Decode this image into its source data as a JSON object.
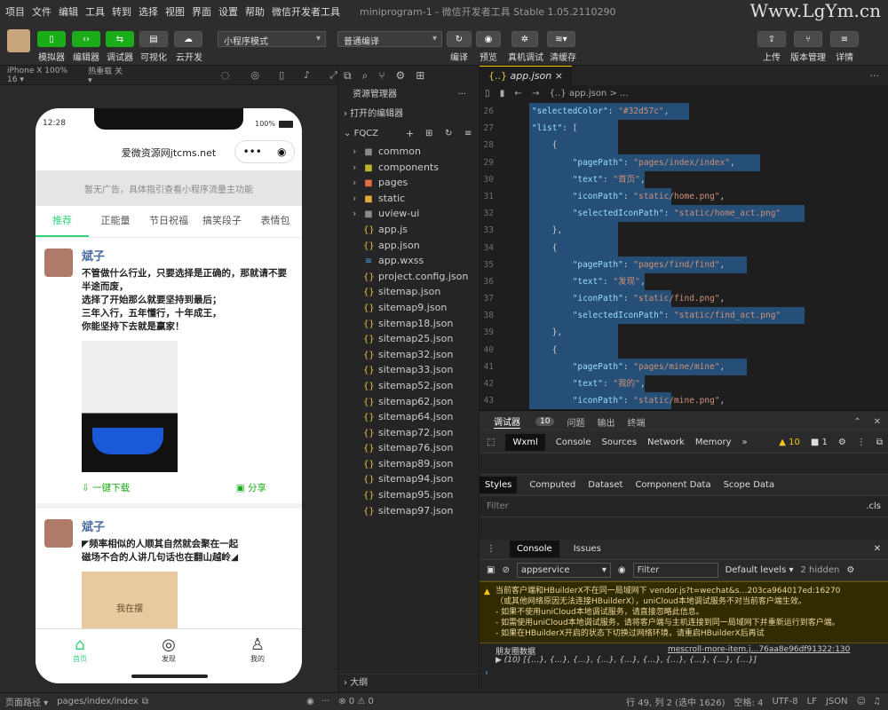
{
  "menu": [
    "项目",
    "文件",
    "编辑",
    "工具",
    "转到",
    "选择",
    "视图",
    "界面",
    "设置",
    "帮助",
    "微信开发者工具"
  ],
  "window_title": "miniprogram-1 - 微信开发者工具 Stable 1.05.2110290",
  "brand": "Www.LgYm.cn",
  "toolbar": {
    "simulator": "模拟器",
    "editor": "编辑器",
    "debugger": "调试器",
    "visual": "可视化",
    "cloud": "云开发",
    "mode": "小程序模式",
    "compile_mode": "普通编译",
    "compile": "编译",
    "preview": "预览",
    "real_debug": "真机调试",
    "clear_cache": "清缓存",
    "upload": "上传",
    "version": "版本管理",
    "details": "详情"
  },
  "simbar": {
    "device": "iPhone X 100% 16 ▾",
    "hotreload": "热重载 关 ▾"
  },
  "phone": {
    "time": "12:28",
    "battery": "100%",
    "nav_title": "爱微资源网jtcms.net",
    "ad": "暂无广告，具体指引查看小程序流量主功能",
    "tabs": [
      "推荐",
      "正能量",
      "节日祝福",
      "搞笑段子",
      "表情包"
    ],
    "posts": [
      {
        "user": "斌子",
        "text": "不管做什么行业，只要选择是正确的，那就请不要半途而废，\n选择了开始那么就要坚持到最后；\n三年入行，五年懂行，十年成王，\n你能坚持下去就是赢家！",
        "download": "一键下载",
        "share": "分享"
      },
      {
        "user": "斌子",
        "text": "◤频率相似的人顺其自然就会聚在一起\n磁场不合的人讲几句话也在翻山越岭◢",
        "img_text": "我在摆"
      }
    ],
    "bottom": [
      "首页",
      "发现",
      "我的"
    ]
  },
  "explorer": {
    "title": "资源管理器",
    "open_editors": "打开的编辑器",
    "project": "FQCZ",
    "outline": "大纲",
    "files": [
      {
        "name": "common",
        "type": "folder",
        "color": "#8a8a8a"
      },
      {
        "name": "components",
        "type": "folder",
        "color": "#c0b22a"
      },
      {
        "name": "pages",
        "type": "folder",
        "color": "#e06c4a"
      },
      {
        "name": "static",
        "type": "folder",
        "color": "#e0a83a"
      },
      {
        "name": "uview-ui",
        "type": "folder",
        "color": "#8a8a8a"
      },
      {
        "name": "app.js",
        "type": "js",
        "color": "#e8c03a"
      },
      {
        "name": "app.json",
        "type": "json",
        "color": "#e8c03a"
      },
      {
        "name": "app.wxss",
        "type": "wxss",
        "color": "#4aa0e0"
      },
      {
        "name": "project.config.json",
        "type": "json",
        "color": "#e8c03a"
      },
      {
        "name": "sitemap.json",
        "type": "json",
        "color": "#e8c03a"
      },
      {
        "name": "sitemap9.json",
        "type": "json",
        "color": "#e8c03a"
      },
      {
        "name": "sitemap18.json",
        "type": "json",
        "color": "#e8c03a"
      },
      {
        "name": "sitemap25.json",
        "type": "json",
        "color": "#e8c03a"
      },
      {
        "name": "sitemap32.json",
        "type": "json",
        "color": "#e8c03a"
      },
      {
        "name": "sitemap33.json",
        "type": "json",
        "color": "#e8c03a"
      },
      {
        "name": "sitemap52.json",
        "type": "json",
        "color": "#e8c03a"
      },
      {
        "name": "sitemap62.json",
        "type": "json",
        "color": "#e8c03a"
      },
      {
        "name": "sitemap64.json",
        "type": "json",
        "color": "#e8c03a"
      },
      {
        "name": "sitemap72.json",
        "type": "json",
        "color": "#e8c03a"
      },
      {
        "name": "sitemap76.json",
        "type": "json",
        "color": "#e8c03a"
      },
      {
        "name": "sitemap89.json",
        "type": "json",
        "color": "#e8c03a"
      },
      {
        "name": "sitemap94.json",
        "type": "json",
        "color": "#e8c03a"
      },
      {
        "name": "sitemap95.json",
        "type": "json",
        "color": "#e8c03a"
      },
      {
        "name": "sitemap97.json",
        "type": "json",
        "color": "#e8c03a"
      }
    ]
  },
  "editor": {
    "tab": "app.json",
    "breadcrumb": "{..} app.json > ...",
    "lines": [
      {
        "n": "26",
        "ind": 3,
        "c": [
          [
            "k",
            "\"selectedColor\""
          ],
          [
            "p",
            ": "
          ],
          [
            "s",
            "\"#32d57c\""
          ],
          [
            "p",
            ","
          ]
        ]
      },
      {
        "n": "27",
        "ind": 3,
        "c": [
          [
            "k",
            "\"list\""
          ],
          [
            "p",
            ": ["
          ]
        ]
      },
      {
        "n": "28",
        "ind": 4,
        "c": [
          [
            "p",
            "{"
          ]
        ]
      },
      {
        "n": "29",
        "ind": 5,
        "c": [
          [
            "k",
            "\"pagePath\""
          ],
          [
            "p",
            ": "
          ],
          [
            "s",
            "\"pages/index/index\""
          ],
          [
            "p",
            ","
          ]
        ]
      },
      {
        "n": "30",
        "ind": 5,
        "c": [
          [
            "k",
            "\"text\""
          ],
          [
            "p",
            ": "
          ],
          [
            "s",
            "\"首页\""
          ],
          [
            "p",
            ","
          ]
        ]
      },
      {
        "n": "31",
        "ind": 5,
        "c": [
          [
            "k",
            "\"iconPath\""
          ],
          [
            "p",
            ": "
          ],
          [
            "s",
            "\"static/home.png\""
          ],
          [
            "p",
            ","
          ]
        ]
      },
      {
        "n": "32",
        "ind": 5,
        "c": [
          [
            "k",
            "\"selectedIconPath\""
          ],
          [
            "p",
            ": "
          ],
          [
            "s",
            "\"static/home_act.png\""
          ]
        ]
      },
      {
        "n": "33",
        "ind": 4,
        "c": [
          [
            "p",
            "},"
          ]
        ]
      },
      {
        "n": "34",
        "ind": 4,
        "c": [
          [
            "p",
            "{"
          ]
        ]
      },
      {
        "n": "35",
        "ind": 5,
        "c": [
          [
            "k",
            "\"pagePath\""
          ],
          [
            "p",
            ": "
          ],
          [
            "s",
            "\"pages/find/find\""
          ],
          [
            "p",
            ","
          ]
        ]
      },
      {
        "n": "36",
        "ind": 5,
        "c": [
          [
            "k",
            "\"text\""
          ],
          [
            "p",
            ": "
          ],
          [
            "s",
            "\"发现\""
          ],
          [
            "p",
            ","
          ]
        ]
      },
      {
        "n": "37",
        "ind": 5,
        "c": [
          [
            "k",
            "\"iconPath\""
          ],
          [
            "p",
            ": "
          ],
          [
            "s",
            "\"static/find.png\""
          ],
          [
            "p",
            ","
          ]
        ]
      },
      {
        "n": "38",
        "ind": 5,
        "c": [
          [
            "k",
            "\"selectedIconPath\""
          ],
          [
            "p",
            ": "
          ],
          [
            "s",
            "\"static/find_act.png\""
          ]
        ]
      },
      {
        "n": "39",
        "ind": 4,
        "c": [
          [
            "p",
            "},"
          ]
        ]
      },
      {
        "n": "40",
        "ind": 4,
        "c": [
          [
            "p",
            "{"
          ]
        ]
      },
      {
        "n": "41",
        "ind": 5,
        "c": [
          [
            "k",
            "\"pagePath\""
          ],
          [
            "p",
            ": "
          ],
          [
            "s",
            "\"pages/mine/mine\""
          ],
          [
            "p",
            ","
          ]
        ]
      },
      {
        "n": "42",
        "ind": 5,
        "c": [
          [
            "k",
            "\"text\""
          ],
          [
            "p",
            ": "
          ],
          [
            "s",
            "\"我的\""
          ],
          [
            "p",
            ","
          ]
        ]
      },
      {
        "n": "43",
        "ind": 5,
        "c": [
          [
            "k",
            "\"iconPath\""
          ],
          [
            "p",
            ": "
          ],
          [
            "s",
            "\"static/mine.png\""
          ],
          [
            "p",
            ","
          ]
        ]
      }
    ]
  },
  "devtools": {
    "tabs": [
      "调试器",
      "问题",
      "输出",
      "终端"
    ],
    "badge": "10",
    "sub": [
      "Wxml",
      "Console",
      "Sources",
      "Network",
      "Memory"
    ],
    "warn_count": "10",
    "err_count": "1",
    "panels": [
      "Styles",
      "Computed",
      "Dataset",
      "Component Data",
      "Scope Data"
    ],
    "filter": "Filter",
    "cls": ".cls",
    "console_tabs": [
      "Console",
      "Issues"
    ],
    "context": "appservice",
    "filter_placeholder": "Filter",
    "levels": "Default levels ▾",
    "hidden": "2 hidden",
    "warn_lines": [
      "当前客户端和HBuilderX不在同一局域网下 vendor.js?t=wechat&s…203ca964017ed:16270",
      "（或其他网络原因无法连接HBuilderX），uniCloud本地调试服务不对当前客户端生效。",
      "- 如果不使用uniCloud本地调试服务，请直接忽略此信息。",
      "- 如需使用uniCloud本地调试服务，请将客户端与主机连接到同一局域网下并重新运行到客户端。",
      "- 如果在HBuilderX开启的状态下切换过网络环境，请重启HBuilderX后再试"
    ],
    "log_label": "朋友圈数据",
    "log_src": "mescroll-more-item.j…76aa8e96df91322:130",
    "log_val": "▶ (10) [{…}, {…}, {…}, {…}, {…}, {…}, {…}, {…}, {…}, {…}]"
  },
  "status": {
    "path_label": "页面路径 ▾",
    "path": "pages/index/index",
    "problems": "⊗ 0 ⚠ 0",
    "pos": "行 49, 列 2 (选中 1626)",
    "spaces": "空格: 4",
    "enc": "UTF-8",
    "eol": "LF",
    "lang": "JSON"
  },
  "colors": {
    "accent": "#1aad19",
    "tab_active": "#32d57c"
  }
}
